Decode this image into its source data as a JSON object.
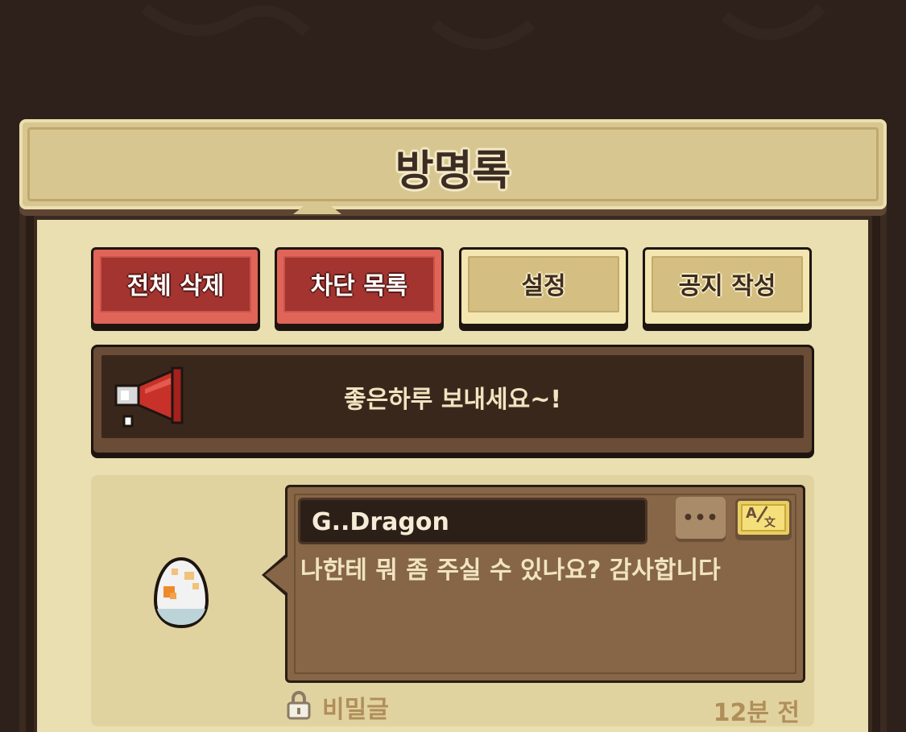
{
  "header": {
    "title": "방명록"
  },
  "toolbar": {
    "delete_all_label": "전체 삭제",
    "block_list_label": "차단 목록",
    "settings_label": "설정",
    "write_notice_label": "공지 작성"
  },
  "notice": {
    "text": "좋은하루 보내세요~!"
  },
  "entry": {
    "author": "G..Dragon",
    "message": "나한테 뭐 좀 주실 수 있나요? 감사합니다",
    "more_label": "•••",
    "visibility": "비밀글",
    "time": "12분 전"
  },
  "colors": {
    "background": "#2e211c",
    "panel": "#e9dfb0",
    "red_button": "#e06458",
    "tan_button": "#f3e6b0",
    "bubble": "#866647"
  },
  "icons": [
    "megaphone-icon",
    "egg-avatar-icon",
    "more-options-icon",
    "translate-icon",
    "lock-icon"
  ]
}
